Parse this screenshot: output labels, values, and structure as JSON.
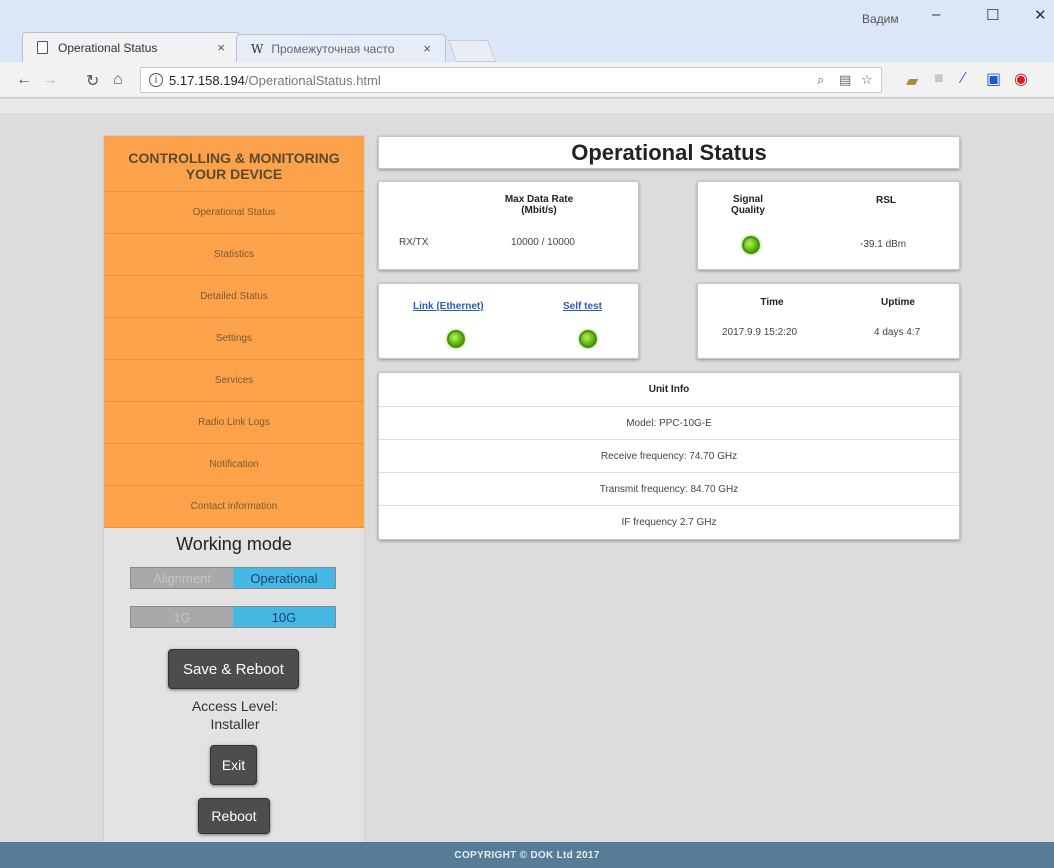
{
  "browser": {
    "tabs": [
      {
        "title": "Operational Status",
        "close": "×"
      },
      {
        "title": "Промежуточная часто",
        "icon": "W",
        "close": "×"
      }
    ],
    "window_user": "Вадим",
    "window_controls": {
      "minimize": "–",
      "maximize": "☐",
      "close": "✕"
    },
    "url_host": "5.17.158.194",
    "url_path": "/OperationalStatus.html",
    "info_glyph": "i"
  },
  "sidebar": {
    "header_line1": "CONTROLLING & MONITORING",
    "header_line2": "YOUR DEVICE",
    "items": [
      "Operational Status",
      "Statistics",
      "Detailed Status",
      "Settings",
      "Services",
      "Radio Link Logs",
      "Notification",
      "Contact information"
    ],
    "working_mode_title": "Working mode",
    "mode_toggle": {
      "off": "Alignment",
      "on": "Operational"
    },
    "speed_toggle": {
      "off": "1G",
      "on": "10G"
    },
    "save_reboot": "Save & Reboot",
    "access_label": "Access Level:",
    "access_value": "Installer",
    "exit": "Exit",
    "reboot": "Reboot"
  },
  "main": {
    "title": "Operational Status",
    "rate_card": {
      "header_line1": "Max Data Rate",
      "header_line2": "(Mbit/s)",
      "row_label": "RX/TX",
      "row_value": "10000 / 10000"
    },
    "signal_card": {
      "sq_line1": "Signal",
      "sq_line2": "Quality",
      "rsl_header": "RSL",
      "rsl_value": "-39.1 dBm"
    },
    "link_card": {
      "link_label": "Link (Ethernet)",
      "selftest_label": "Self test"
    },
    "time_card": {
      "time_header": "Time",
      "uptime_header": "Uptime",
      "time_value": "2017.9.9 15:2:20",
      "uptime_value": "4 days 4:7"
    },
    "unit_info": {
      "header": "Unit Info",
      "rows": [
        "Model: PPC-10G-E",
        "Receive frequency: 74.70 GHz",
        "Transmit frequency: 84.70 GHz",
        "IF frequency 2.7 GHz"
      ]
    }
  },
  "footer": "COPYRIGHT © DOK Ltd 2017",
  "colors": {
    "menu": "#fba24b",
    "toggle_on": "#45b9e6",
    "led": "#58b20e",
    "footer": "#567c96"
  }
}
